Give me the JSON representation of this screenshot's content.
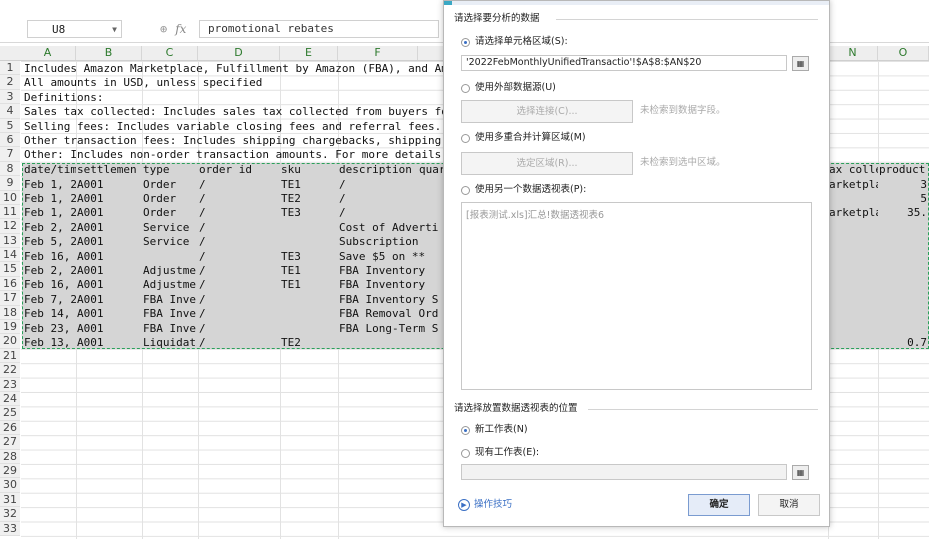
{
  "formula_bar": {
    "name_box": "U8",
    "fx_icons": "⊕",
    "fx_label": "fx",
    "formula_value": "promotional rebates"
  },
  "columns": [
    "A",
    "B",
    "C",
    "D",
    "E",
    "F",
    "",
    "",
    "",
    "",
    "",
    "",
    "",
    "N",
    "O"
  ],
  "rows": [
    "1",
    "2",
    "3",
    "4",
    "5",
    "6",
    "7",
    "8",
    "9",
    "10",
    "11",
    "12",
    "13",
    "14",
    "15",
    "16",
    "17",
    "18",
    "19",
    "20",
    "21",
    "22",
    "23",
    "24",
    "25",
    "26",
    "27",
    "28",
    "29",
    "30",
    "31",
    "32",
    "33"
  ],
  "sheet": {
    "r1": "Includes Amazon Marketplace, Fulfillment by Amazon (FBA), and Amaz",
    "r2": "All amounts in USD, unless specified",
    "r3": "Definitions:",
    "r4": "Sales tax collected: Includes sales tax collected from buyers for",
    "r5": "Selling fees: Includes variable closing fees and referral fees.",
    "r6": "Other transaction fees: Includes shipping chargebacks, shipping ho",
    "r7": "Other: Includes non-order transaction amounts. For more details, s",
    "header": [
      "date/time",
      "settlemen",
      "type",
      "order id",
      "sku",
      "description",
      "quar"
    ],
    "header_right": [
      "ax colle",
      "product"
    ],
    "data": [
      {
        "a": "Feb 1, 20",
        "b": "A001",
        "c": "Order",
        "d": "/",
        "e": "TE1",
        "f": "/",
        "n": "arketpla",
        "o": "3"
      },
      {
        "a": "Feb 1, 20",
        "b": "A001",
        "c": "Order",
        "d": "/",
        "e": "TE2",
        "f": "/",
        "n": "",
        "o": "5"
      },
      {
        "a": "Feb 1, 20",
        "b": "A001",
        "c": "Order",
        "d": "/",
        "e": "TE3",
        "f": "/",
        "n": "arketpla",
        "o": "35."
      },
      {
        "a": "Feb 2, 20",
        "b": "A001",
        "c": "Service F",
        "d": "/",
        "e": "",
        "f": "Cost of Advertisi",
        "n": "",
        "o": ""
      },
      {
        "a": "Feb 5, 20",
        "b": "A001",
        "c": "Service F",
        "d": "/",
        "e": "",
        "f": "Subscription",
        "n": "",
        "o": ""
      },
      {
        "a": "Feb 16, 2",
        "b": "A001",
        "c": "",
        "d": "/",
        "e": "TE3",
        "f": "Save $5 on **",
        "n": "",
        "o": ""
      },
      {
        "a": "Feb 2, 20",
        "b": "A001",
        "c": "Adjustmer",
        "d": "/",
        "e": "TE1",
        "f": "FBA Inventory",
        "n": "",
        "o": ""
      },
      {
        "a": "Feb 16, 2",
        "b": "A001",
        "c": "Adjustmer",
        "d": "/",
        "e": "TE1",
        "f": "FBA Inventory",
        "n": "",
        "o": ""
      },
      {
        "a": "Feb 7, 20",
        "b": "A001",
        "c": "FBA Inver",
        "d": "/",
        "e": "",
        "f": "FBA Inventory St",
        "n": "",
        "o": ""
      },
      {
        "a": "Feb 14, 2",
        "b": "A001",
        "c": "FBA Inver",
        "d": "/",
        "e": "",
        "f": "FBA Removal Orde",
        "n": "",
        "o": ""
      },
      {
        "a": "Feb 23, 2",
        "b": "A001",
        "c": "FBA Inver",
        "d": "/",
        "e": "",
        "f": "FBA Long-Term St",
        "n": "",
        "o": ""
      },
      {
        "a": "Feb 13, 2",
        "b": "A001",
        "c": "Liquidati",
        "d": "/",
        "e": "TE2",
        "f": "",
        "n": "",
        "o": "0.7"
      }
    ]
  },
  "dialog": {
    "section1_title": "请选择要分析的数据",
    "opt_range_label": "请选择单元格区域(S):",
    "range_value": "'2022FebMonthlyUnifiedTransactio'!$A$8:$AN$20",
    "opt_external_label": "使用外部数据源(U)",
    "select_connection_btn": "选择连接(C)...",
    "no_field_hint": "未检索到数据字段。",
    "opt_multi_label": "使用多重合并计算区域(M)",
    "select_area_btn": "选定区域(R)...",
    "no_area_hint": "未检索到选中区域。",
    "opt_other_pivot_label": "使用另一个数据透视表(P):",
    "pivot_list_item": "[报表测试.xls]汇总!数据透视表6",
    "section2_title": "请选择放置数据透视表的位置",
    "opt_new_sheet_label": "新工作表(N)",
    "opt_existing_sheet_label": "现有工作表(E):",
    "tips_label": "操作技巧",
    "ok_label": "确定",
    "cancel_label": "取消",
    "pick_icon": "▦"
  }
}
